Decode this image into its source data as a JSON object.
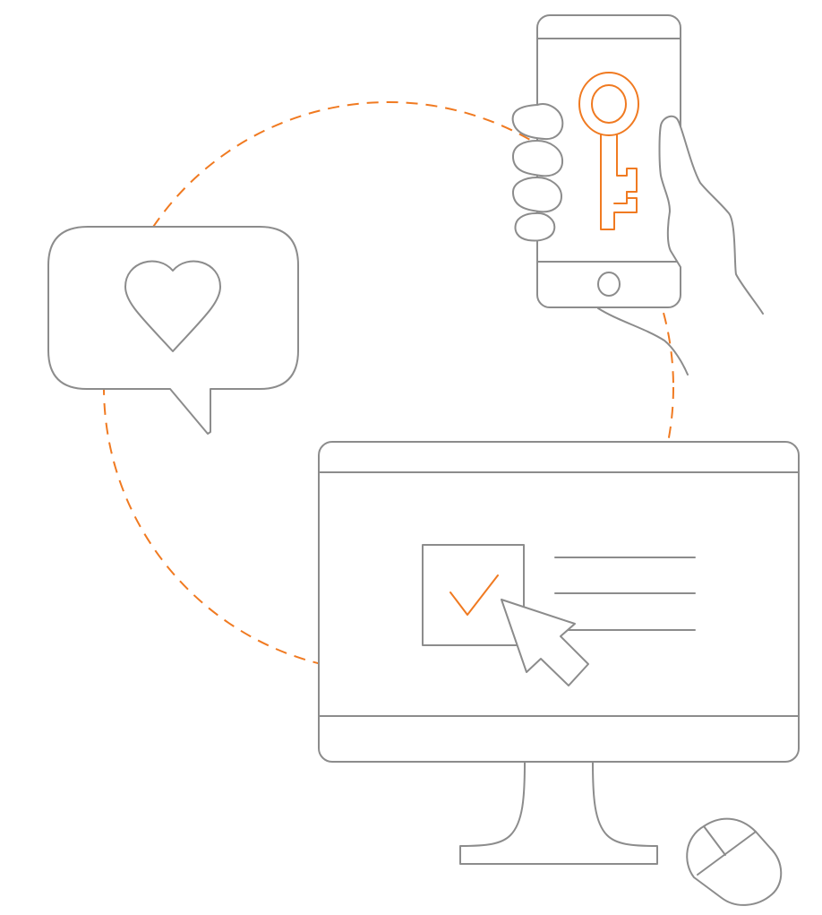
{
  "illustration": {
    "scene": "secure-login-concept",
    "colors": {
      "outline": "#8c8c8c",
      "accent": "#f07a21",
      "background": "#ffffff"
    },
    "icons": [
      "dashed-orbit-circle",
      "heart-speech-bubble-icon",
      "smartphone-icon",
      "key-icon",
      "hand-icon",
      "desktop-monitor-icon",
      "checkbox-icon",
      "checkmark-icon",
      "cursor-arrow-icon",
      "text-lines-icon",
      "mouse-icon"
    ],
    "checkbox_checked": true
  }
}
